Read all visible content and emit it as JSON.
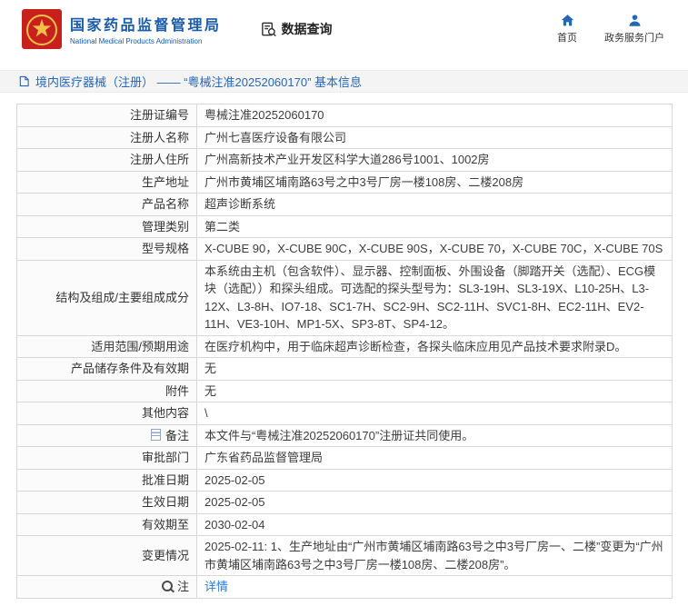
{
  "colors": {
    "brand_blue": "#1b5aa7",
    "icon_blue": "#2468b2",
    "link_blue": "#2a7ae2",
    "emblem_red": "#c8201d",
    "emblem_gold": "#f3c14b",
    "crumb_bg": "#f4f4f4"
  },
  "header": {
    "agency_cn": "国家药品监督管理局",
    "agency_en": "National Medical Products Administration",
    "section_label": "数据查询",
    "nav": [
      {
        "label": "首页",
        "icon": "home-icon"
      },
      {
        "label": "政务服务门户",
        "icon": "user-icon"
      }
    ]
  },
  "breadcrumb": {
    "text": "境内医疗器械（注册） —— “粤械注准20252060170” 基本信息"
  },
  "table": {
    "rows": [
      {
        "label": "注册证编号",
        "value": "粤械注准20252060170"
      },
      {
        "label": "注册人名称",
        "value": "广州七喜医疗设备有限公司"
      },
      {
        "label": "注册人住所",
        "value": "广州高新技术产业开发区科学大道286号1001、1002房"
      },
      {
        "label": "生产地址",
        "value": "广州市黄埔区埔南路63号之中3号厂房一楼108房、二楼208房"
      },
      {
        "label": "产品名称",
        "value": "超声诊断系统"
      },
      {
        "label": "管理类别",
        "value": "第二类"
      },
      {
        "label": "型号规格",
        "value": "X-CUBE 90，X-CUBE 90C，X-CUBE 90S，X-CUBE 70，X-CUBE 70C，X-CUBE 70S"
      },
      {
        "label": "结构及组成/主要组成成分",
        "value": "本系统由主机（包含软件）、显示器、控制面板、外围设备（脚踏开关（选配）、ECG模块（选配））和探头组成。可选配的探头型号为：SL3-19H、SL3-19X、L10-25H、L3-12X、L3-8H、IO7-18、SC1-7H、SC2-9H、SC2-11H、SVC1-8H、EC2-11H、EV2-11H、VE3-10H、MP1-5X、SP3-8T、SP4-12。"
      },
      {
        "label": "适用范围/预期用途",
        "value": "在医疗机构中，用于临床超声诊断检查，各探头临床应用见产品技术要求附录D。"
      },
      {
        "label": "产品储存条件及有效期",
        "value": "无"
      },
      {
        "label": "附件",
        "value": "无"
      },
      {
        "label": "其他内容",
        "value": "\\"
      },
      {
        "label": "备注",
        "value": "本文件与“粤械注准20252060170”注册证共同使用。",
        "icon": "remark-doc-icon"
      },
      {
        "label": "审批部门",
        "value": "广东省药品监督管理局"
      },
      {
        "label": "批准日期",
        "value": "2025-02-05"
      },
      {
        "label": "生效日期",
        "value": "2025-02-05"
      },
      {
        "label": "有效期至",
        "value": "2030-02-04"
      },
      {
        "label": "变更情况",
        "value": "2025-02-11: 1、生产地址由“广州市黄埔区埔南路63号之中3号厂房一、二楼”变更为“广州市黄埔区埔南路63号之中3号厂房一楼108房、二楼208房”。"
      },
      {
        "label": "注",
        "value": "详情",
        "icon": "note-magnifier-icon",
        "link": true
      }
    ]
  }
}
